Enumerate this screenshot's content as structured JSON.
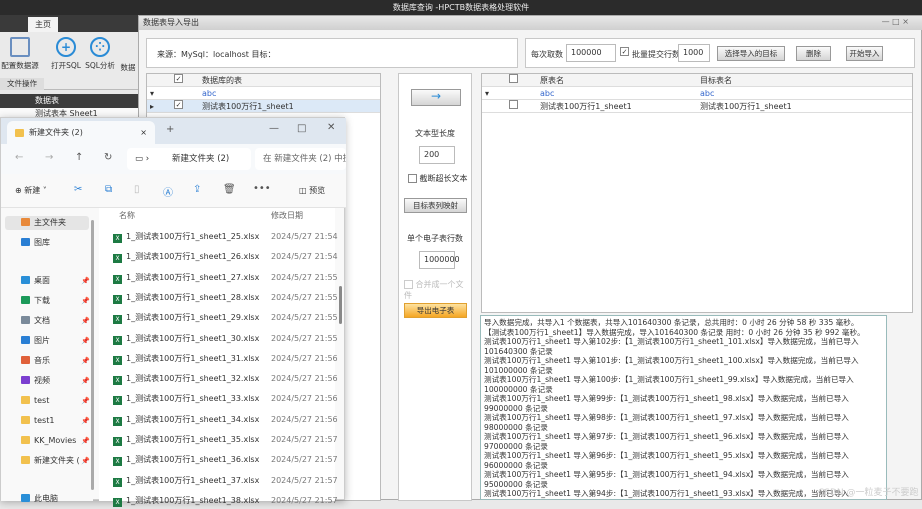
{
  "app": {
    "title": "数据库查询 -HPCTB数据表格处理软件",
    "tab_home": "主页",
    "ribbon": [
      {
        "label": "配置数据源",
        "icon": "monitor-icon"
      },
      {
        "label": "打开SQL",
        "icon": "plus-circle-icon"
      },
      {
        "label": "SQL分析",
        "icon": "sql-analysis-icon"
      },
      {
        "label": "数据",
        "icon": ""
      }
    ],
    "group_label": "文件操作",
    "left_header": "数据表",
    "left_row": "测试表本 Sheet1"
  },
  "dialog": {
    "title": "数据表导入导出",
    "source_label": "来源：MySql：localhost 目标：",
    "per_fetch_label": "每次取数",
    "per_fetch_value": "100000",
    "batch_checked": true,
    "batch_label": "批量提交行数",
    "batch_value": "1000",
    "select_target_btn": "选择导入的目标",
    "delete_btn": "删除",
    "start_btn": "开始导入",
    "left_grid": {
      "header": "数据库的表",
      "filter": "abc",
      "rows": [
        {
          "checked": true,
          "name": "测试表100万行1_sheet1"
        }
      ]
    },
    "middle": {
      "arrow_btn": "→",
      "text_len_label": "文本型长度",
      "text_len_value": "200",
      "truncate_label": "截断超长文本",
      "truncate_checked": false,
      "map_btn": "目标表列映射",
      "rows_per_sheet_label": "单个电子表行数",
      "rows_per_sheet_value": "1000000",
      "merge_label": "合并成一个文件",
      "merge_checked": false,
      "export_btn": "导出电子表"
    },
    "right_grid": {
      "col1": "原表名",
      "col2": "目标表名",
      "filter": "abc",
      "rows": [
        {
          "checked": false,
          "src": "测试表100万行1_sheet1",
          "dst": "测试表100万行1_sheet1"
        }
      ]
    },
    "log": [
      "导入数据完成，共导入1 个数据表，共导入101640300 条记录，总共用时：0 小时 26 分钟 58 秒 335 毫秒。",
      "【测试表100万行1_sheet1】导入数据完成，导入101640300 条记录 用时：0 小时 26 分钟 35 秒 992 毫秒。",
      "测试表100万行1_sheet1 导入第102步:【1_测试表100万行1_sheet1_101.xlsx】导入数据完成，当前已导入101640300 条记录",
      "测试表100万行1_sheet1 导入第101步:【1_测试表100万行1_sheet1_100.xlsx】导入数据完成，当前已导入101000000 条记录",
      "测试表100万行1_sheet1 导入第100步:【1_测试表100万行1_sheet1_99.xlsx】导入数据完成，当前已导入100000000 条记录",
      "测试表100万行1_sheet1 导入第99步:【1_测试表100万行1_sheet1_98.xlsx】导入数据完成，当前已导入99000000 条记录",
      "测试表100万行1_sheet1 导入第98步:【1_测试表100万行1_sheet1_97.xlsx】导入数据完成，当前已导入98000000 条记录",
      "测试表100万行1_sheet1 导入第97步:【1_测试表100万行1_sheet1_96.xlsx】导入数据完成，当前已导入97000000 条记录",
      "测试表100万行1_sheet1 导入第96步:【1_测试表100万行1_sheet1_95.xlsx】导入数据完成，当前已导入96000000 条记录",
      "测试表100万行1_sheet1 导入第95步:【1_测试表100万行1_sheet1_94.xlsx】导入数据完成，当前已导入95000000 条记录",
      "测试表100万行1_sheet1 导入第94步:【1_测试表100万行1_sheet1_93.xlsx】导入数据完成，当前已导入94000000 条记录"
    ]
  },
  "explorer": {
    "tab_title": "新建文件夹 (2)",
    "address": "新建文件夹 (2)",
    "search_placeholder": "在 新建文件夹 (2) 中搜索",
    "new_btn": "新建",
    "preview_btn": "预览",
    "col_name": "名称",
    "col_date": "修改日期",
    "sidebar": [
      {
        "label": "主文件夹",
        "color": "#e8893a"
      },
      {
        "label": "图库",
        "color": "#2a7fd4"
      },
      {
        "label": "桌面",
        "color": "#2a8fd8",
        "pin": true
      },
      {
        "label": "下载",
        "color": "#1c9a5a",
        "pin": true
      },
      {
        "label": "文档",
        "color": "#7a8a9a",
        "pin": true
      },
      {
        "label": "图片",
        "color": "#2a7fd4",
        "pin": true
      },
      {
        "label": "音乐",
        "color": "#e0603a",
        "pin": true
      },
      {
        "label": "视频",
        "color": "#7b3fd0",
        "pin": true
      },
      {
        "label": "test",
        "color": "#f2c14e",
        "pin": true
      },
      {
        "label": "test1",
        "color": "#f2c14e",
        "pin": true
      },
      {
        "label": "KK_Movies",
        "color": "#f2c14e",
        "pin": true
      },
      {
        "label": "新建文件夹 (",
        "color": "#f2c14e",
        "pin": true
      },
      {
        "label": "此电脑",
        "color": "#2a8fd8"
      }
    ],
    "files": [
      {
        "name": "1_测试表100万行1_sheet1_25.xlsx",
        "date": "2024/5/27 21:54"
      },
      {
        "name": "1_测试表100万行1_sheet1_26.xlsx",
        "date": "2024/5/27 21:54"
      },
      {
        "name": "1_测试表100万行1_sheet1_27.xlsx",
        "date": "2024/5/27 21:55"
      },
      {
        "name": "1_测试表100万行1_sheet1_28.xlsx",
        "date": "2024/5/27 21:55"
      },
      {
        "name": "1_测试表100万行1_sheet1_29.xlsx",
        "date": "2024/5/27 21:55"
      },
      {
        "name": "1_测试表100万行1_sheet1_30.xlsx",
        "date": "2024/5/27 21:55"
      },
      {
        "name": "1_测试表100万行1_sheet1_31.xlsx",
        "date": "2024/5/27 21:56"
      },
      {
        "name": "1_测试表100万行1_sheet1_32.xlsx",
        "date": "2024/5/27 21:56"
      },
      {
        "name": "1_测试表100万行1_sheet1_33.xlsx",
        "date": "2024/5/27 21:56"
      },
      {
        "name": "1_测试表100万行1_sheet1_34.xlsx",
        "date": "2024/5/27 21:56"
      },
      {
        "name": "1_测试表100万行1_sheet1_35.xlsx",
        "date": "2024/5/27 21:57"
      },
      {
        "name": "1_测试表100万行1_sheet1_36.xlsx",
        "date": "2024/5/27 21:57"
      },
      {
        "name": "1_测试表100万行1_sheet1_37.xlsx",
        "date": "2024/5/27 21:57"
      },
      {
        "name": "1_测试表100万行1_sheet1_38.xlsx",
        "date": "2024/5/27 21:57"
      }
    ]
  },
  "watermark": "CSDN @一粒麦子不要跑"
}
